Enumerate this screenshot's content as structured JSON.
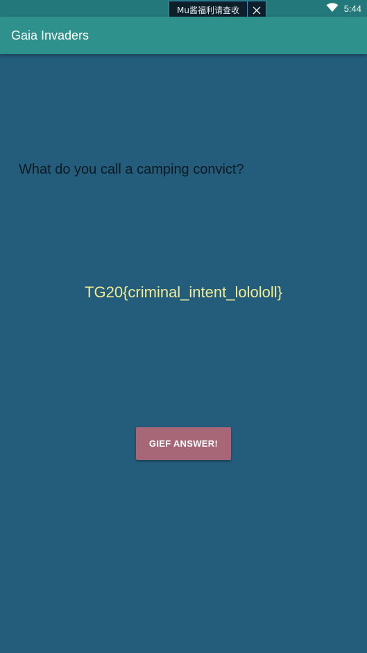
{
  "status_bar": {
    "notification_text": "Mu酱福利请查收",
    "time": "5:44",
    "icons": [
      "wifi-icon",
      "close-icon"
    ]
  },
  "app_bar": {
    "title": "Gaia Invaders"
  },
  "content": {
    "question": "What do you call a camping convict?",
    "answer": "TG20{criminal_intent_lolololl}",
    "button_label": "GIEF ANSWER!"
  },
  "colors": {
    "background": "#245c7c",
    "app_bar": "#2e918b",
    "answer_text": "#f0ec94",
    "button": "#a86777"
  }
}
